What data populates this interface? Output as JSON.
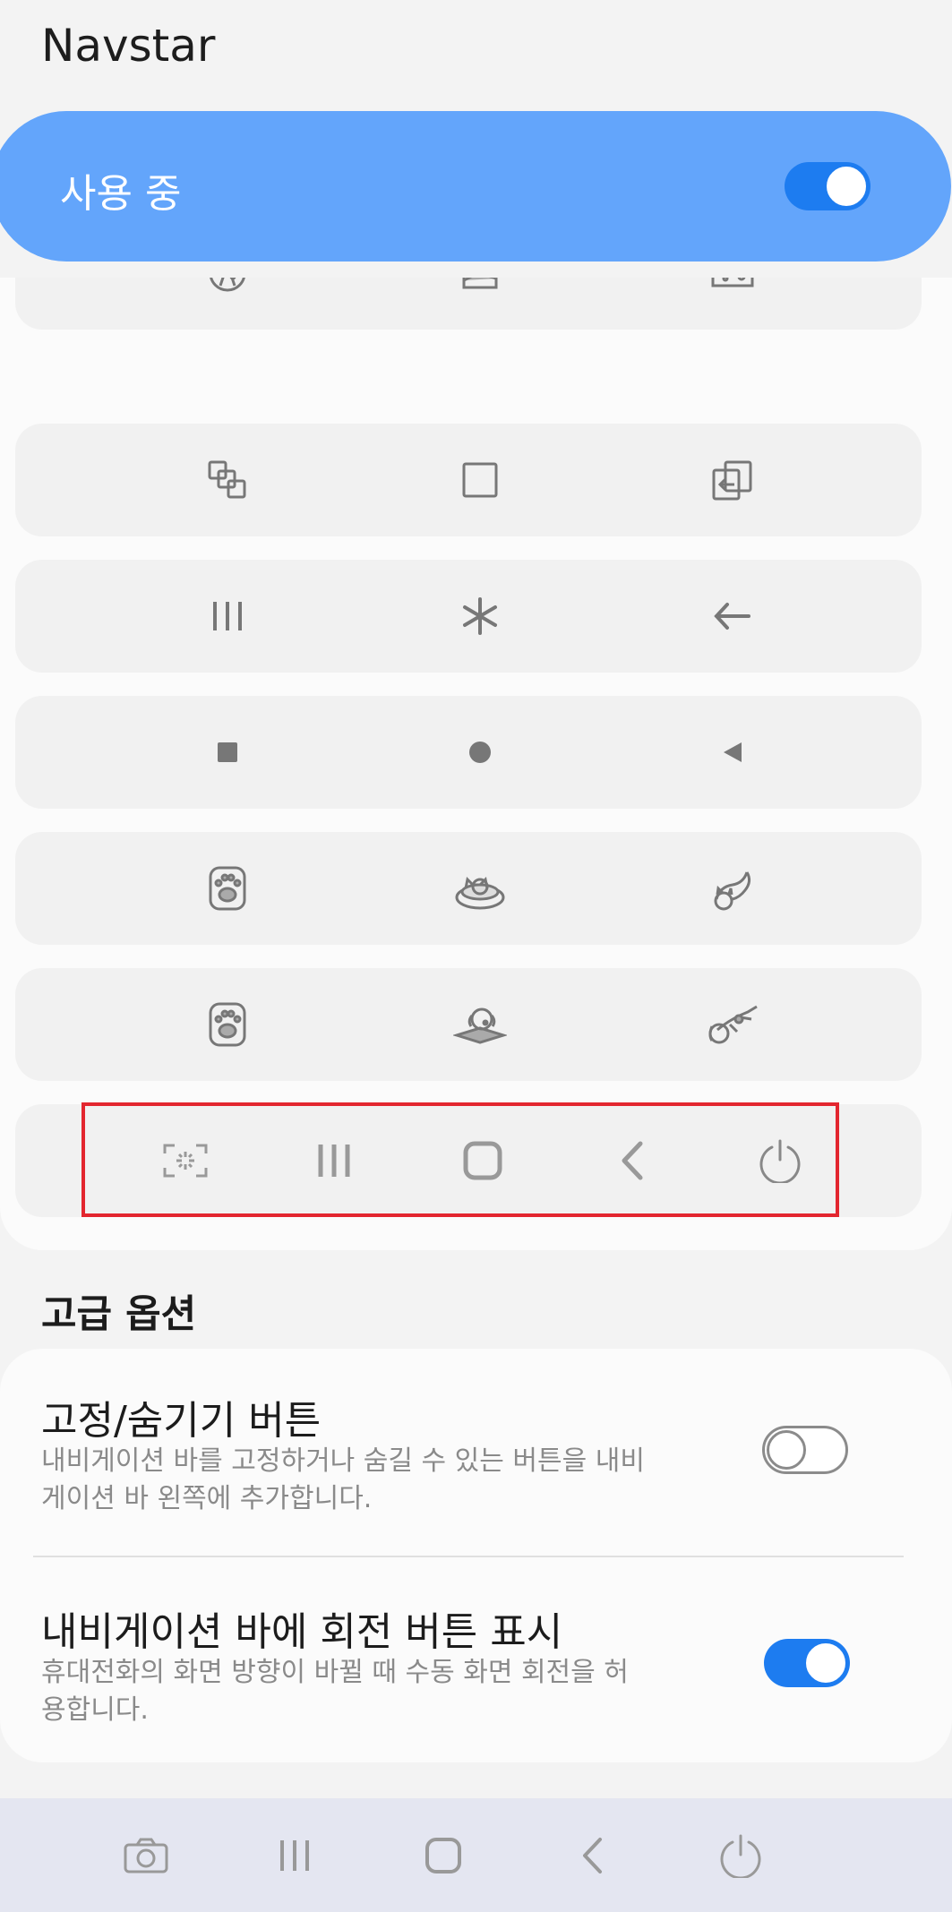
{
  "app_title": "Navstar",
  "master": {
    "label": "사용 중",
    "enabled": true
  },
  "button_sets": [
    {
      "icons": [
        "pizza-icon",
        "cake-slice-icon",
        "cheese-icon"
      ]
    },
    {
      "icons": [
        "recent-apps-overlap-icon",
        "home-square-icon",
        "back-arrow-box-icon"
      ]
    },
    {
      "icons": [
        "recent-apps-lines-icon",
        "home-asterisk-icon",
        "back-arrow-icon"
      ]
    },
    {
      "icons": [
        "recent-apps-filled-square-icon",
        "home-filled-circle-icon",
        "back-filled-triangle-icon"
      ]
    },
    {
      "icons": [
        "cat-paw-icon",
        "cat-sleeping-bed-icon",
        "cat-stretching-icon"
      ]
    },
    {
      "icons": [
        "dog-paw-icon",
        "dog-bed-icon",
        "dog-jumping-icon"
      ]
    }
  ],
  "selected_set": {
    "icons": [
      "screen-capture-icon",
      "recent-apps-icon",
      "home-icon",
      "back-icon",
      "power-icon"
    ]
  },
  "advanced": {
    "section_title": "고급 옵션",
    "items": [
      {
        "title": "고정/숨기기 버튼",
        "description": "내비게이션 바를 고정하거나 숨길 수 있는 버튼을 내비게이션 바 왼쪽에 추가합니다.",
        "enabled": false
      },
      {
        "title": "내비게이션 바에 회전 버튼 표시",
        "description": "휴대전화의 화면 방향이 바뀔 때 수동 화면 회전을 허용합니다.",
        "enabled": true
      }
    ]
  },
  "system_nav": {
    "icons": [
      "camera-icon",
      "recent-apps-icon",
      "home-icon",
      "back-icon",
      "power-icon"
    ]
  },
  "colors": {
    "accent": "#1d7cf0",
    "master_bg": "#63a5fb",
    "selection": "#e3262f",
    "icon": "#777777"
  }
}
